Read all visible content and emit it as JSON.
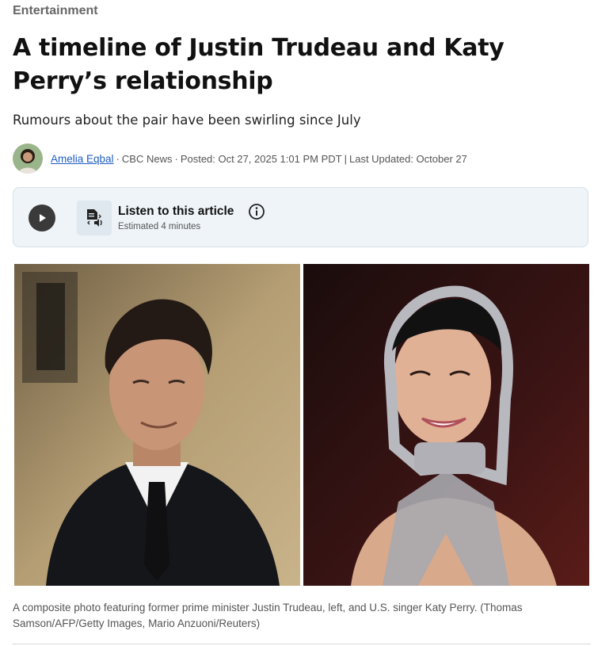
{
  "section": {
    "label": "Entertainment"
  },
  "article": {
    "headline": "A timeline of Justin Trudeau and Katy Perry’s relationship",
    "deck": "Rumours about the pair have been swirling since July"
  },
  "byline": {
    "author": "Amelia Eqbal",
    "source": "CBC News",
    "posted": "Posted: Oct 27, 2025 1:01 PM PDT",
    "divider": "|",
    "updated": "Last Updated: October 27"
  },
  "audio": {
    "title": "Listen to this article",
    "duration": "Estimated 4 minutes"
  },
  "photo": {
    "caption": "A composite photo featuring former prime minister Justin Trudeau, left, and U.S. singer Katy Perry. (Thomas Samson/AFP/Getty Images, Mario Anzuoni/Reuters)"
  }
}
